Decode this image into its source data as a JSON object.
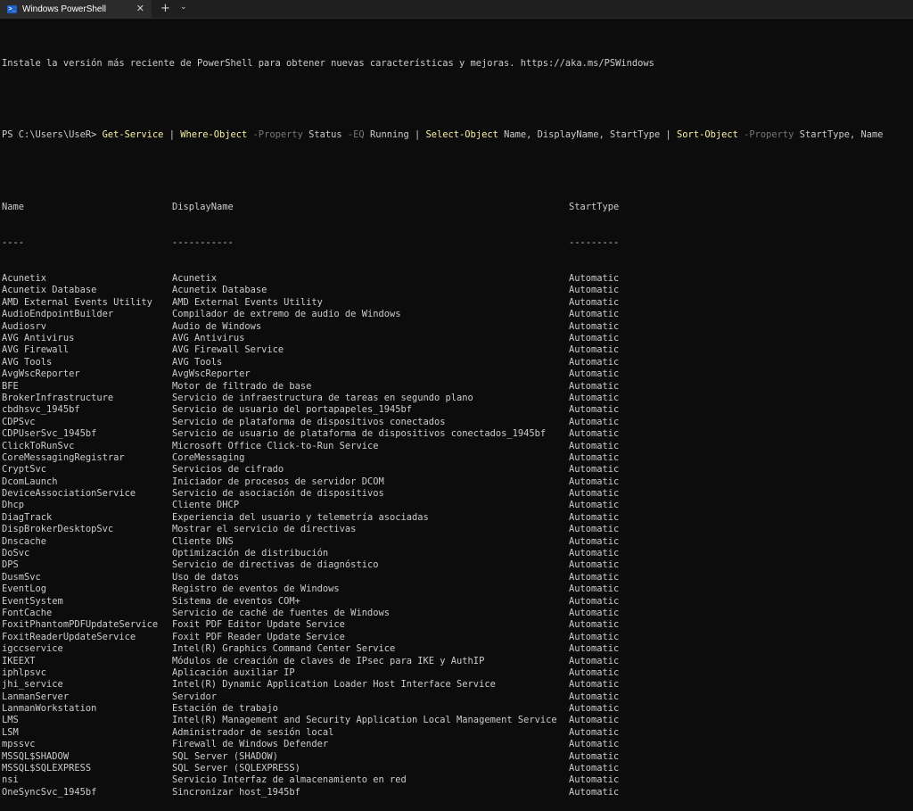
{
  "window": {
    "tab_title": "Windows PowerShell",
    "tab_icon_glyph": ">_",
    "close_glyph": "✕",
    "new_tab_glyph": "+",
    "dropdown_glyph": "⌄"
  },
  "terminal": {
    "banner": "Instale la versión más reciente de PowerShell para obtener nuevas características y mejoras. https://aka.ms/PSWindows",
    "prompt": "PS C:\\Users\\UseR> ",
    "command": {
      "p1": "Get-Service",
      "pipe1": " | ",
      "p2": "Where-Object",
      "p3": " -Property",
      "p4": " Status",
      "p5": " -EQ",
      "p6": " Running",
      "pipe2": " | ",
      "p7": "Select-Object",
      "p8": " Name, DisplayName, StartType",
      "pipe3": " | ",
      "p9": "Sort-Object",
      "p10": " -Property",
      "p11": " StartType, Name"
    },
    "headers": {
      "name": "Name",
      "display": "DisplayName",
      "start": "StartType"
    },
    "separators": {
      "name": "----",
      "display": "-----------",
      "start": "---------"
    },
    "rows": [
      [
        "Acunetix",
        "Acunetix",
        "Automatic"
      ],
      [
        "Acunetix Database",
        "Acunetix Database",
        "Automatic"
      ],
      [
        "AMD External Events Utility",
        "AMD External Events Utility",
        "Automatic"
      ],
      [
        "AudioEndpointBuilder",
        "Compilador de extremo de audio de Windows",
        "Automatic"
      ],
      [
        "Audiosrv",
        "Audio de Windows",
        "Automatic"
      ],
      [
        "AVG Antivirus",
        "AVG Antivirus",
        "Automatic"
      ],
      [
        "AVG Firewall",
        "AVG Firewall Service",
        "Automatic"
      ],
      [
        "AVG Tools",
        "AVG Tools",
        "Automatic"
      ],
      [
        "AvgWscReporter",
        "AvgWscReporter",
        "Automatic"
      ],
      [
        "BFE",
        "Motor de filtrado de base",
        "Automatic"
      ],
      [
        "BrokerInfrastructure",
        "Servicio de infraestructura de tareas en segundo plano",
        "Automatic"
      ],
      [
        "cbdhsvc_1945bf",
        "Servicio de usuario del portapapeles_1945bf",
        "Automatic"
      ],
      [
        "CDPSvc",
        "Servicio de plataforma de dispositivos conectados",
        "Automatic"
      ],
      [
        "CDPUserSvc_1945bf",
        "Servicio de usuario de plataforma de dispositivos conectados_1945bf",
        "Automatic"
      ],
      [
        "ClickToRunSvc",
        "Microsoft Office Click-to-Run Service",
        "Automatic"
      ],
      [
        "CoreMessagingRegistrar",
        "CoreMessaging",
        "Automatic"
      ],
      [
        "CryptSvc",
        "Servicios de cifrado",
        "Automatic"
      ],
      [
        "DcomLaunch",
        "Iniciador de procesos de servidor DCOM",
        "Automatic"
      ],
      [
        "DeviceAssociationService",
        "Servicio de asociación de dispositivos",
        "Automatic"
      ],
      [
        "Dhcp",
        "Cliente DHCP",
        "Automatic"
      ],
      [
        "DiagTrack",
        "Experiencia del usuario y telemetría asociadas",
        "Automatic"
      ],
      [
        "DispBrokerDesktopSvc",
        "Mostrar el servicio de directivas",
        "Automatic"
      ],
      [
        "Dnscache",
        "Cliente DNS",
        "Automatic"
      ],
      [
        "DoSvc",
        "Optimización de distribución",
        "Automatic"
      ],
      [
        "DPS",
        "Servicio de directivas de diagnóstico",
        "Automatic"
      ],
      [
        "DusmSvc",
        "Uso de datos",
        "Automatic"
      ],
      [
        "EventLog",
        "Registro de eventos de Windows",
        "Automatic"
      ],
      [
        "EventSystem",
        "Sistema de eventos COM+",
        "Automatic"
      ],
      [
        "FontCache",
        "Servicio de caché de fuentes de Windows",
        "Automatic"
      ],
      [
        "FoxitPhantomPDFUpdateService",
        "Foxit PDF Editor Update Service",
        "Automatic"
      ],
      [
        "FoxitReaderUpdateService",
        "Foxit PDF Reader Update Service",
        "Automatic"
      ],
      [
        "igccservice",
        "Intel(R) Graphics Command Center Service",
        "Automatic"
      ],
      [
        "IKEEXT",
        "Módulos de creación de claves de IPsec para IKE y AuthIP",
        "Automatic"
      ],
      [
        "iphlpsvc",
        "Aplicación auxiliar IP",
        "Automatic"
      ],
      [
        "jhi_service",
        "Intel(R) Dynamic Application Loader Host Interface Service",
        "Automatic"
      ],
      [
        "LanmanServer",
        "Servidor",
        "Automatic"
      ],
      [
        "LanmanWorkstation",
        "Estación de trabajo",
        "Automatic"
      ],
      [
        "LMS",
        "Intel(R) Management and Security Application Local Management Service",
        "Automatic"
      ],
      [
        "LSM",
        "Administrador de sesión local",
        "Automatic"
      ],
      [
        "mpssvc",
        "Firewall de Windows Defender",
        "Automatic"
      ],
      [
        "MSSQL$SHADOW",
        "SQL Server (SHADOW)",
        "Automatic"
      ],
      [
        "MSSQL$SQLEXPRESS",
        "SQL Server (SQLEXPRESS)",
        "Automatic"
      ],
      [
        "nsi",
        "Servicio Interfaz de almacenamiento en red",
        "Automatic"
      ],
      [
        "OneSyncSvc_1945bf",
        "Sincronizar host_1945bf",
        "Automatic"
      ]
    ]
  }
}
